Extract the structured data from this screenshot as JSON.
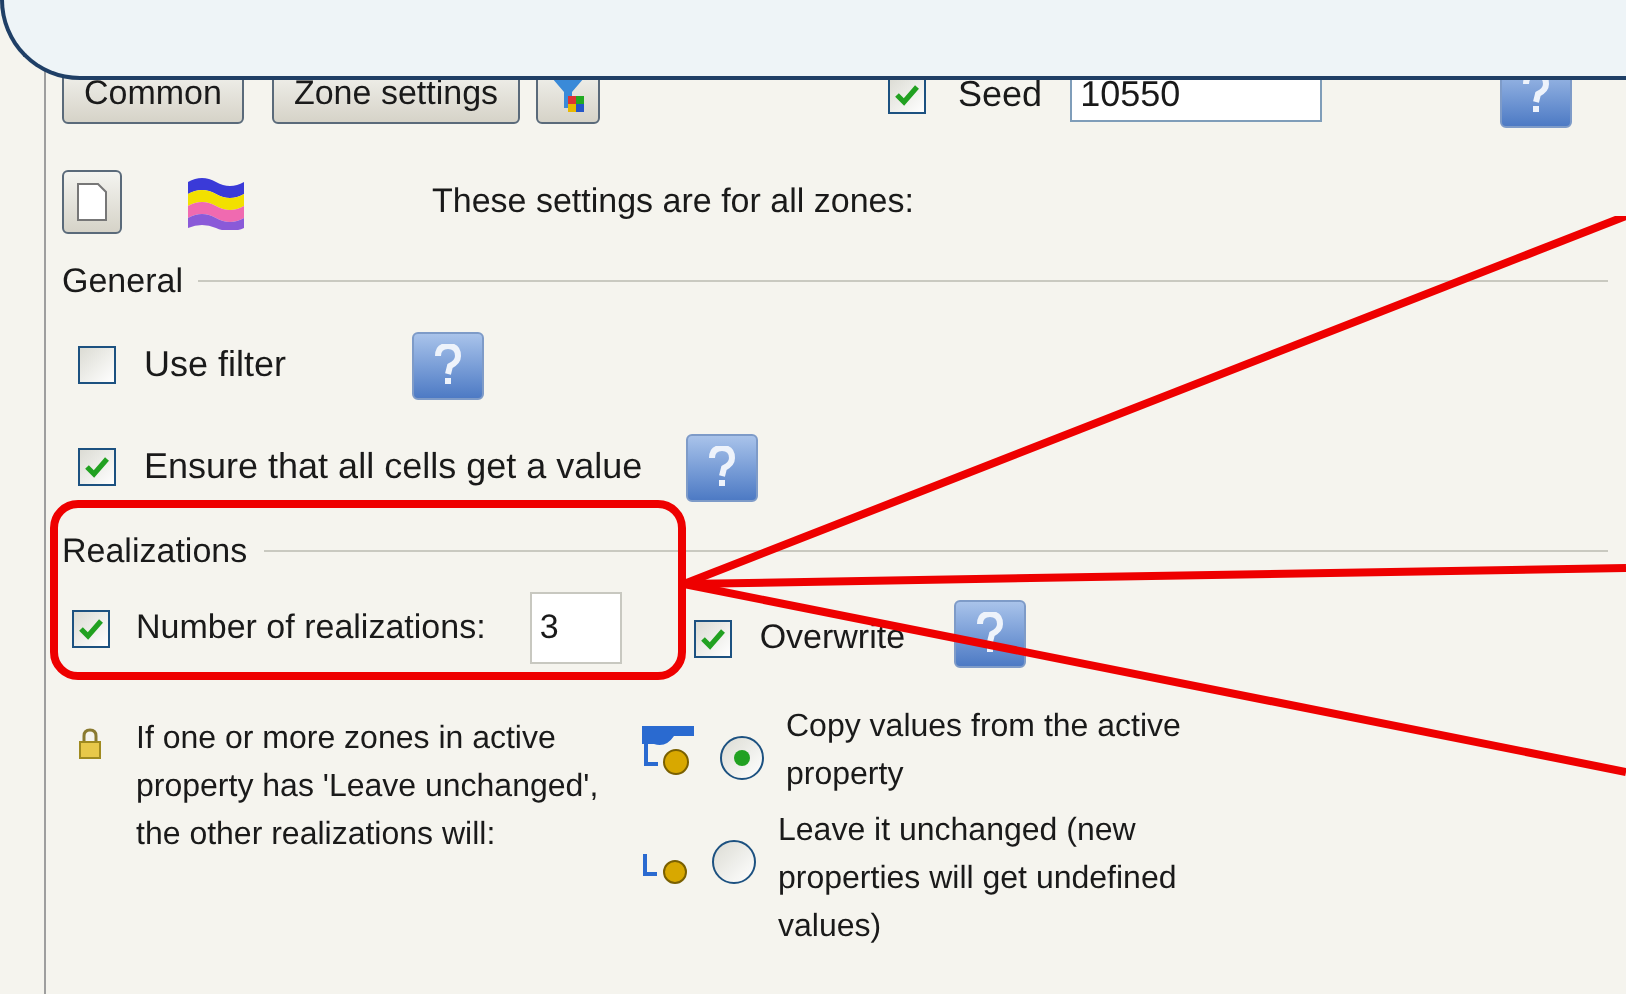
{
  "buttons": [
    {
      "label": "Common",
      "kind": "text"
    },
    {
      "label": "Zone settings",
      "kind": "text"
    },
    {
      "kind": "icon"
    }
  ],
  "seed": {
    "label": "Seed",
    "checked": true,
    "value": "10550"
  },
  "intro": "These settings are for all zones:",
  "general": {
    "title": "General",
    "options": [
      {
        "label": "Use filter",
        "checked": false
      },
      {
        "label": "Ensure that all cells get a value",
        "checked": true
      }
    ]
  },
  "realizations": {
    "title": "Realizations",
    "count_label": "Number of realizations:",
    "count_checked": true,
    "count_value": "3",
    "overwrite_label": "Overwrite",
    "overwrite_checked": true
  },
  "note": "If one or more zones in active property has 'Leave unchanged', the other realizations will:",
  "choices": [
    {
      "label": "Copy values from the active property",
      "selected": true
    },
    {
      "label": "Leave it unchanged (new properties will get undefined values)",
      "selected": false
    }
  ]
}
